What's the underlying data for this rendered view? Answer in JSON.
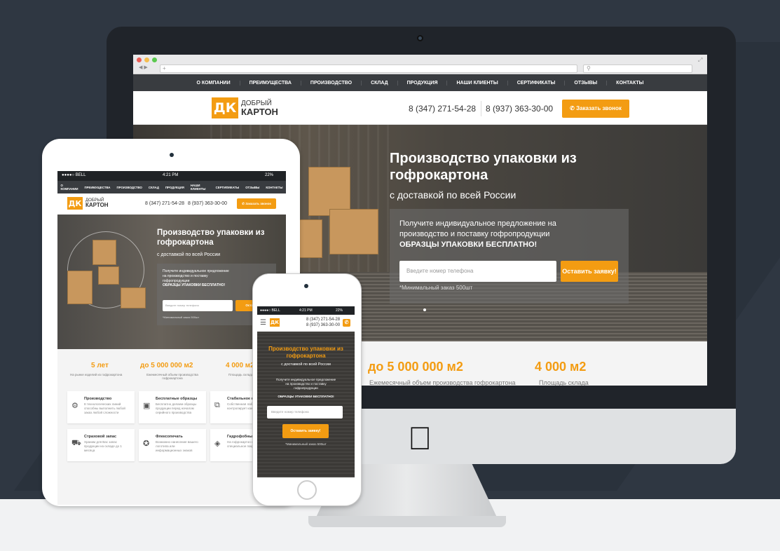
{
  "browser": {
    "url": "+",
    "search_placeholder": ""
  },
  "nav": [
    "О КОМПАНИИ",
    "ПРЕИМУЩЕСТВА",
    "ПРОИЗВОДСТВО",
    "СКЛАД",
    "ПРОДУКЦИЯ",
    "НАШИ КЛИЕНТЫ",
    "СЕРТИФИКАТЫ",
    "ОТЗЫВЫ",
    "КОНТАКТЫ"
  ],
  "logo": {
    "mark": "ДК",
    "line1": "ДОБРЫЙ",
    "line2": "КАРТОН"
  },
  "phones": [
    "8 (347) 271-54-28",
    "8 (937) 363-30-00"
  ],
  "callback_button": "Заказать звонок",
  "hero": {
    "title_line1": "Производство упаковки из",
    "title_line2": "гофрокартона",
    "subtitle": "с доставкой по всей России",
    "offer_line1": "Получите индивидуальное предложение на",
    "offer_line2": "производство и поставку гофропродукции",
    "offer_bold": "ОБРАЗЦЫ УПАКОВКИ БЕСПЛАТНО!",
    "input_placeholder": "Введите номер телефона",
    "submit_button": "Оставить заявку!",
    "min_order": "*Минимальный заказ 500шт"
  },
  "stats": [
    {
      "value": "5 лет",
      "label": "На рынке изделий из гофрокартона"
    },
    {
      "value": "до 5 000 000 м2",
      "label": "Ежемесячный объем производства гофрокартона"
    },
    {
      "value": "4 000 м2",
      "label": "Площадь склада"
    }
  ],
  "status_bar": {
    "carrier": "●●●●○ BELL",
    "time": "4:21 PM",
    "battery": "22%"
  },
  "tablet": {
    "offer_line1": "Получите индивидуальное предложение",
    "offer_line2": "на производство и поставку",
    "offer_line3": "гофропродукции",
    "submit_short": "Оставить",
    "features": [
      {
        "title": "Производство",
        "text": "8 технологических линий способны выполнить любой заказ любой сложности"
      },
      {
        "title": "Бесплатные образцы",
        "text": "Бесплатно делаем образцы продукции перед началом серийного производства"
      },
      {
        "title": "Стабильное ка",
        "text": "Собственная лаборатория контролирует каждый этап"
      },
      {
        "title": "Страховой запас",
        "text": "Храним для Вас запас продукции на складе до 1 месяца"
      },
      {
        "title": "Флексопечать",
        "text": "Возможно нанесение вашего логотипа или информационных знаков"
      },
      {
        "title": "Гидрофобные",
        "text": "На гофрокартон наносится специальное покрытие"
      }
    ]
  },
  "phone_device": {
    "title_line1": "Производство упаковки из",
    "title_line2": "гофрокартона",
    "offer_line1": "Получите индивидуальное предложение",
    "offer_line2": "на производство и поставку",
    "offer_line3": "гофропродукции"
  }
}
